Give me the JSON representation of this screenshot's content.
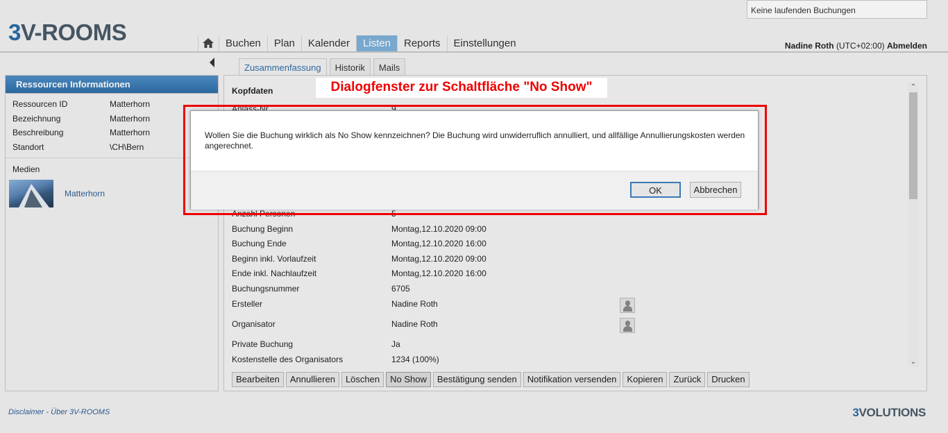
{
  "header": {
    "status_box": "Keine laufenden Buchungen",
    "logo": {
      "part1": "3",
      "part2": "V-ROOMS"
    },
    "user": {
      "name": "Nadine Roth",
      "tz": "(UTC+02:00)",
      "logout": "Abmelden"
    }
  },
  "nav": [
    {
      "label": "Buchen"
    },
    {
      "label": "Plan"
    },
    {
      "label": "Kalender"
    },
    {
      "label": "Listen",
      "active": true
    },
    {
      "label": "Reports"
    },
    {
      "label": "Einstellungen"
    }
  ],
  "left_panel": {
    "title": "Ressourcen Informationen",
    "rows": [
      {
        "label": "Ressourcen ID",
        "value": "Matterhorn"
      },
      {
        "label": "Bezeichnung",
        "value": "Matterhorn"
      },
      {
        "label": "Beschreibung",
        "value": "Matterhorn"
      },
      {
        "label": "Standort",
        "value": "\\CH\\Bern"
      }
    ],
    "media_label": "Medien",
    "media_link": "Matterhorn"
  },
  "tabs": [
    {
      "label": "Zusammenfassung",
      "active": true
    },
    {
      "label": "Historik"
    },
    {
      "label": "Mails"
    }
  ],
  "main": {
    "section_title": "Kopfdaten",
    "partial_rows": [
      {
        "label": "Anlass-Nr",
        "value": "9"
      },
      {
        "label": "Anzahl Personen",
        "value": "5"
      }
    ],
    "fields": [
      {
        "label": "Buchung Beginn",
        "value": "Montag,12.10.2020 09:00"
      },
      {
        "label": "Buchung Ende",
        "value": "Montag,12.10.2020 16:00"
      },
      {
        "label": "Beginn inkl. Vorlaufzeit",
        "value": "Montag,12.10.2020 09:00"
      },
      {
        "label": "Ende inkl. Nachlaufzeit",
        "value": "Montag,12.10.2020 16:00"
      },
      {
        "label": "Buchungsnummer",
        "value": "6705"
      },
      {
        "label": "Ersteller",
        "value": "Nadine Roth"
      },
      {
        "label": "Organisator",
        "value": "Nadine Roth"
      },
      {
        "label": "Private Buchung",
        "value": "Ja"
      },
      {
        "label": "Kostenstelle des Organisators",
        "value": "1234 (100%)"
      }
    ],
    "actions": [
      "Bearbeiten",
      "Annullieren",
      "Löschen",
      "No Show",
      "Bestätigung senden",
      "Notifikation versenden",
      "Kopieren",
      "Zurück",
      "Drucken"
    ]
  },
  "footer": {
    "disclaimer": "Disclaimer",
    "separator": "-",
    "about": "Über 3V-ROOMS",
    "brand": {
      "part1": "3",
      "part2": "VOLUTIONS"
    }
  },
  "annotation": "Dialogfenster zur Schaltfläche \"No Show\"",
  "dialog": {
    "message": "Wollen Sie die Buchung wirklich als No Show kennzeichnen? Die Buchung wird unwiderruflich annulliert, und allfällige Annullierungskosten werden angerechnet.",
    "ok": "OK",
    "cancel": "Abbrechen"
  }
}
